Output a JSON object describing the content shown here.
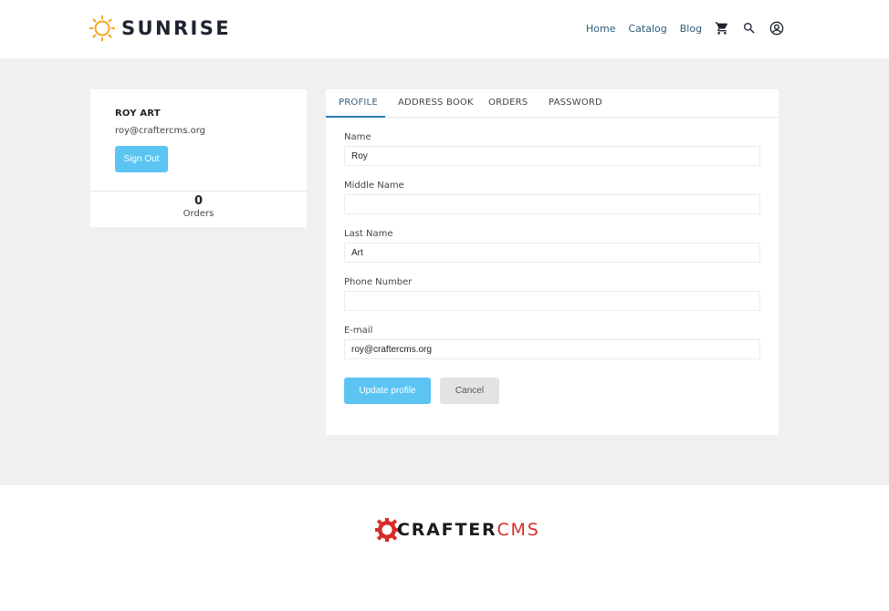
{
  "brand": {
    "name": "SUNRISE",
    "sun_color": "#f5a623"
  },
  "nav": {
    "links": [
      "Home",
      "Catalog",
      "Blog"
    ],
    "icons": [
      "cart-icon",
      "search-icon",
      "account-icon"
    ]
  },
  "user": {
    "name": "ROY ART",
    "email": "roy@craftercms.org",
    "sign_out_label": "Sign Out",
    "orders_count": "0",
    "orders_label": "Orders"
  },
  "tabs": [
    {
      "label": "PROFILE",
      "active": true
    },
    {
      "label": "ADDRESS BOOK",
      "active": false
    },
    {
      "label": "ORDERS",
      "active": false
    },
    {
      "label": "PASSWORD",
      "active": false
    }
  ],
  "form": {
    "name": {
      "label": "Name",
      "value": "Roy"
    },
    "middle_name": {
      "label": "Middle Name",
      "value": ""
    },
    "last_name": {
      "label": "Last Name",
      "value": "Art"
    },
    "phone": {
      "label": "Phone Number",
      "value": ""
    },
    "email": {
      "label": "E-mail",
      "value": "roy@craftercms.org"
    },
    "update_label": "Update profile",
    "cancel_label": "Cancel"
  },
  "footer": {
    "logo_part1": "CRAFTER",
    "logo_part2": "CMS",
    "logo_color": "#d92b2b"
  },
  "colors": {
    "accent": "#5bc4f3",
    "tab_active_underline": "#2a7bb5",
    "background": "#f0f0f1"
  }
}
